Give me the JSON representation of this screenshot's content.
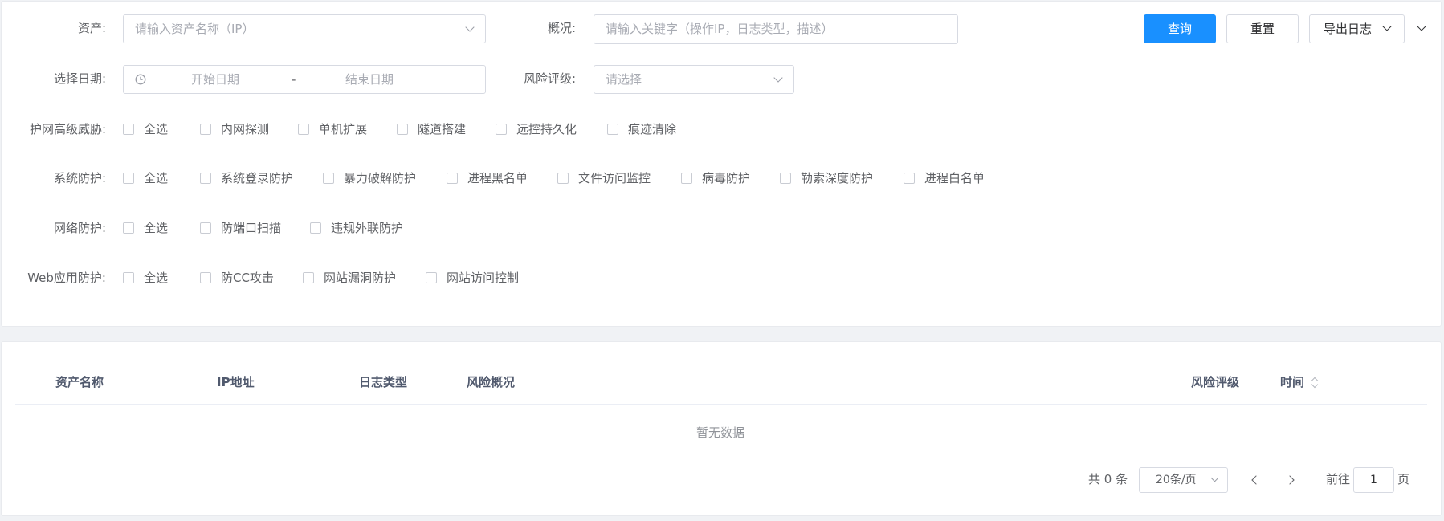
{
  "filters": {
    "asset_label": "资产:",
    "asset_placeholder": "请输入资产名称（IP）",
    "overview_label": "概况:",
    "overview_placeholder": "请输入关键字（操作IP，日志类型，描述）",
    "date_label": "选择日期:",
    "date_start_placeholder": "开始日期",
    "date_separator": "-",
    "date_end_placeholder": "结束日期",
    "risk_label": "风险评级:",
    "risk_placeholder": "请选择"
  },
  "actions": {
    "query_label": "查询",
    "reset_label": "重置",
    "export_label": "导出日志"
  },
  "checkbox_groups": [
    {
      "label": "护网高级威胁:",
      "items": [
        "全选",
        "内网探测",
        "单机扩展",
        "隧道搭建",
        "远控持久化",
        "痕迹清除"
      ]
    },
    {
      "label": "系统防护:",
      "items": [
        "全选",
        "系统登录防护",
        "暴力破解防护",
        "进程黑名单",
        "文件访问监控",
        "病毒防护",
        "勒索深度防护",
        "进程白名单"
      ]
    },
    {
      "label": "网络防护:",
      "items": [
        "全选",
        "防端口扫描",
        "违规外联防护"
      ]
    },
    {
      "label": "Web应用防护:",
      "items": [
        "全选",
        "防CC攻击",
        "网站漏洞防护",
        "网站访问控制"
      ]
    }
  ],
  "table": {
    "columns": [
      "资产名称",
      "IP地址",
      "日志类型",
      "风险概况",
      "风险评级",
      "时间"
    ],
    "empty_text": "暂无数据"
  },
  "pagination": {
    "total_text": "共 0 条",
    "page_size": "20条/页",
    "goto_label": "前往",
    "current_page": "1",
    "page_suffix": "页"
  },
  "colors": {
    "primary": "#1990ff",
    "border": "#d7dae2",
    "background": "#f0f2f5"
  },
  "icons": {
    "clock": "clock-icon",
    "dropdown": "chevron-down-icon",
    "sort": "sort-icon",
    "prev": "chevron-left-icon",
    "next": "chevron-right-icon"
  }
}
